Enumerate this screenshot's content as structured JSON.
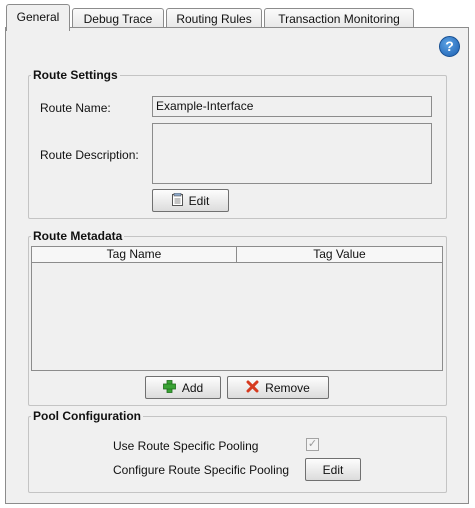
{
  "tabs": [
    {
      "label": "General",
      "active": true
    },
    {
      "label": "Debug Trace",
      "active": false
    },
    {
      "label": "Routing Rules",
      "active": false
    },
    {
      "label": "Transaction Monitoring",
      "active": false
    }
  ],
  "help": {
    "icon": "help-icon",
    "glyph": "?"
  },
  "route_settings": {
    "title": "Route Settings",
    "name_label": "Route Name:",
    "name_value": "Example-Interface",
    "description_label": "Route Description:",
    "description_value": "",
    "edit_button": {
      "label": "Edit",
      "icon": "notepad-icon"
    }
  },
  "route_metadata": {
    "title": "Route Metadata",
    "columns": [
      "Tag Name",
      "Tag Value"
    ],
    "rows": [],
    "add_button": {
      "label": "Add",
      "icon": "plus-icon"
    },
    "remove_button": {
      "label": "Remove",
      "icon": "x-icon"
    }
  },
  "pool_configuration": {
    "title": "Pool Configuration",
    "use_specific_label": "Use Route Specific Pooling",
    "use_specific_checked": true,
    "configure_label": "Configure Route Specific Pooling",
    "configure_button": "Edit"
  },
  "colors": {
    "panel": "#f0f0f0",
    "border": "#8c8c8c",
    "help_blue": "#2a72c8",
    "add_green": "#3aa335",
    "remove_red": "#d63a1f"
  }
}
